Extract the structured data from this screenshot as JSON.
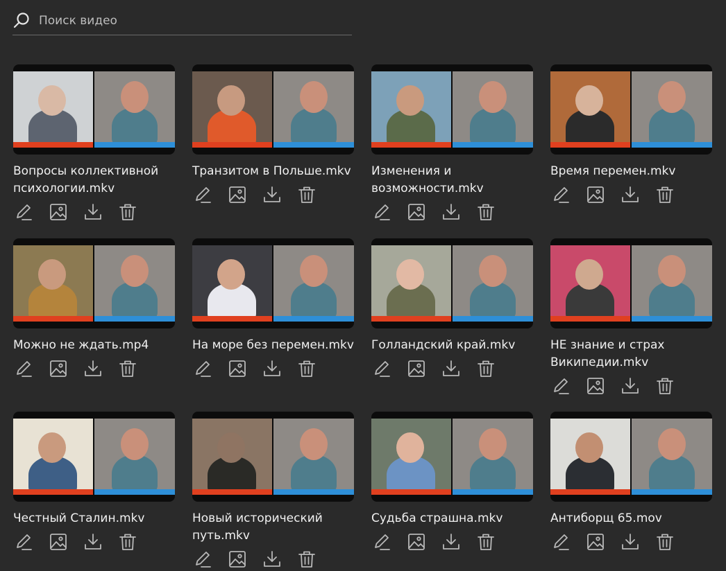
{
  "search": {
    "placeholder": "Поиск видео"
  },
  "colors": {
    "background": "#2a2a2a",
    "left_bar": "#e0401f",
    "right_bar": "#2e8fd8",
    "icon": "#b8b8b8"
  },
  "videos": [
    {
      "title": "Вопросы коллективной психологии.mkv",
      "bg": "#cfd2d4",
      "shirt": "#5d6470",
      "face": "#d9b9a5"
    },
    {
      "title": "Транзитом в Польше.mkv",
      "bg": "#6b5a4e",
      "shirt": "#e05a2b",
      "face": "#c79a80"
    },
    {
      "title": "Изменения и возможности.mkv",
      "bg": "#7da1b8",
      "shirt": "#5b6b4a",
      "face": "#c99a7e"
    },
    {
      "title": "Время перемен.mkv",
      "bg": "#b06a3a",
      "shirt": "#2b2b2b",
      "face": "#d7b39b"
    },
    {
      "title": "Можно не ждать.mp4",
      "bg": "#8c7a52",
      "shirt": "#b4843c",
      "face": "#c99a7e"
    },
    {
      "title": "На море без перемен.mkv",
      "bg": "#3d3d42",
      "shirt": "#e8e8ee",
      "face": "#d2a48a"
    },
    {
      "title": "Голландский край.mkv",
      "bg": "#a6a89a",
      "shirt": "#6b6e50",
      "face": "#e2b9a4"
    },
    {
      "title": "НЕ знание и страх Википедии.mkv",
      "bg": "#c94a6a",
      "shirt": "#3a3a3a",
      "face": "#cfa98f"
    },
    {
      "title": "Честный Сталин.mkv",
      "bg": "#e8e2d4",
      "shirt": "#3e5f86",
      "face": "#c99a7e"
    },
    {
      "title": "Новый исторический путь.mkv",
      "bg": "#8a7564",
      "shirt": "#2a2a26",
      "face": "#8f7462"
    },
    {
      "title": "Судьба страшна.mkv",
      "bg": "#6e7a6a",
      "shirt": "#6c93c4",
      "face": "#e0b39c"
    },
    {
      "title": "Антиборщ 65.mov",
      "bg": "#dcdcd8",
      "shirt": "#2b2e33",
      "face": "#c28f72"
    }
  ]
}
